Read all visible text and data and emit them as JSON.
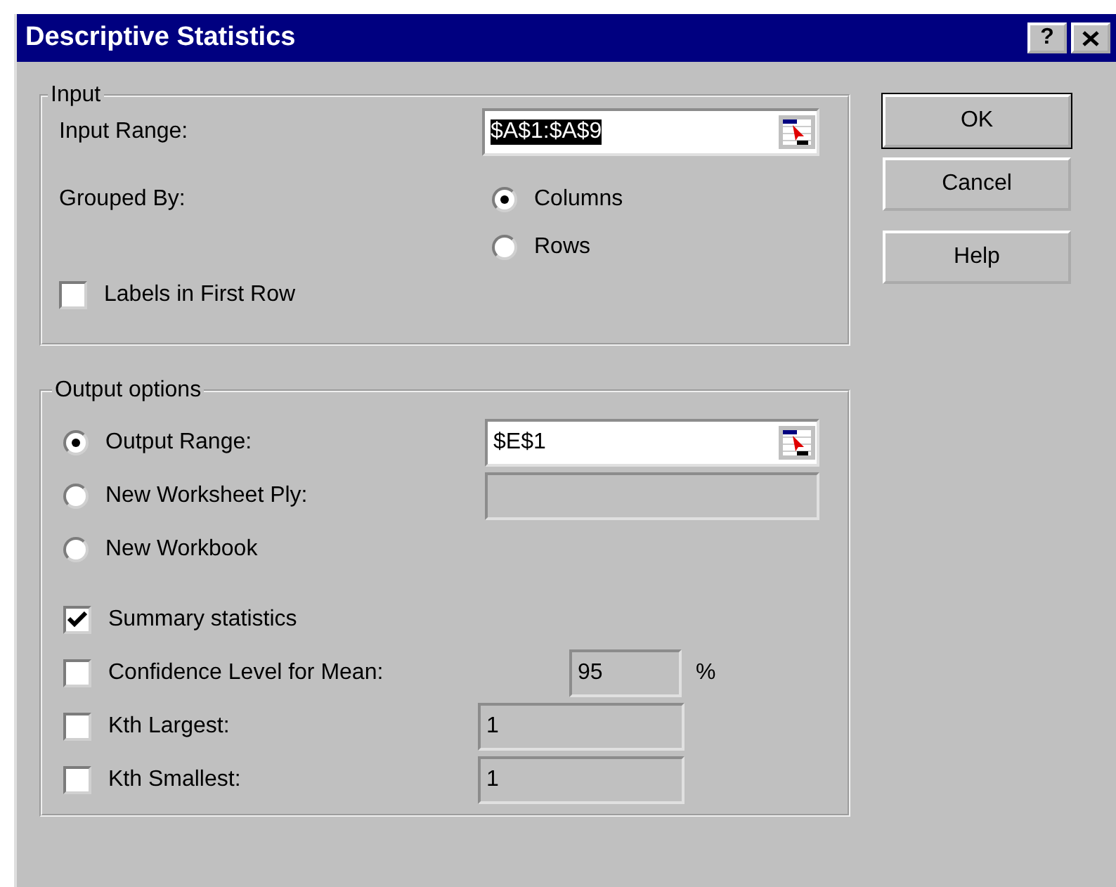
{
  "window": {
    "title": "Descriptive Statistics",
    "help_button": "?"
  },
  "input_group": {
    "label": "Input",
    "input_range": {
      "label": "Input Range:",
      "value": "$A$1:$A$9",
      "text_selected": true
    },
    "grouped_by": {
      "label": "Grouped By:",
      "options": [
        {
          "label": "Columns",
          "selected": true
        },
        {
          "label": "Rows",
          "selected": false
        }
      ]
    },
    "labels_in_first_row": {
      "label": "Labels in First Row",
      "checked": false
    }
  },
  "output_group": {
    "label": "Output options",
    "destinations": [
      {
        "label": "Output Range:",
        "selected": true,
        "field": {
          "value": "$E$1",
          "disabled": false
        }
      },
      {
        "label": "New Worksheet Ply:",
        "selected": false,
        "field": {
          "disabled": true
        }
      },
      {
        "label": "New Workbook",
        "selected": false
      }
    ],
    "options": [
      {
        "kind": "plain",
        "label": "Summary statistics",
        "checked": true
      },
      {
        "kind": "percent",
        "label": "Confidence Level for Mean:",
        "checked": false,
        "field": {
          "value": "95",
          "disabled": true
        },
        "unit": "%"
      },
      {
        "kind": "number",
        "label": "Kth Largest:",
        "checked": false,
        "field": {
          "value": "1",
          "disabled": true
        }
      },
      {
        "kind": "number",
        "label": "Kth Smallest:",
        "checked": false,
        "field": {
          "value": "1",
          "disabled": true
        }
      }
    ]
  },
  "buttons": [
    {
      "label": "OK",
      "default": true
    },
    {
      "label": "Cancel",
      "default": false
    },
    {
      "label": "Help",
      "default": false
    }
  ]
}
